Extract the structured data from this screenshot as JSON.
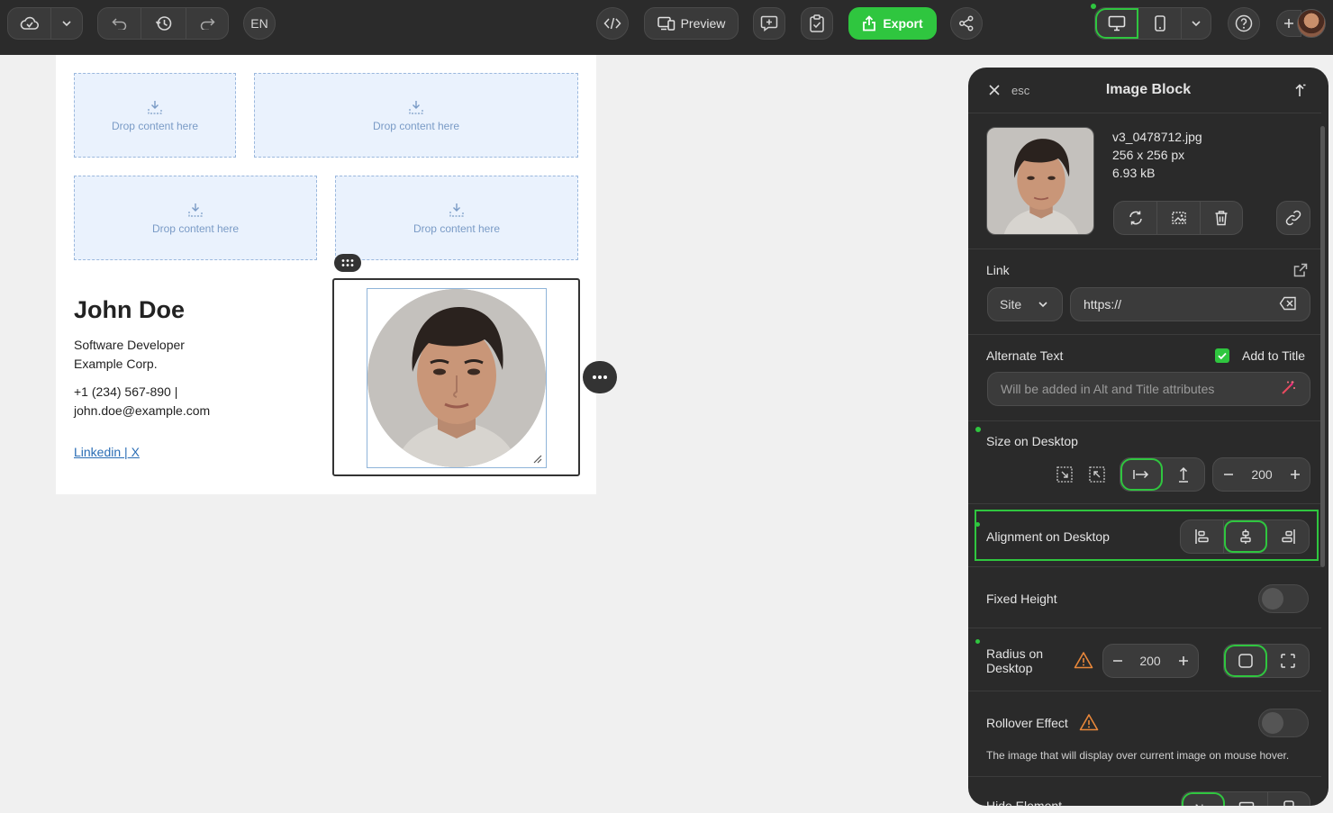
{
  "toolbar": {
    "language": "EN",
    "preview_label": "Preview",
    "export_label": "Export"
  },
  "canvas": {
    "drop_zone_label": "Drop content here",
    "signature": {
      "name": "John Doe",
      "role": "Software Developer",
      "company": "Example Corp.",
      "phone": "+1 (234) 567-890 |",
      "email": "john.doe@example.com",
      "link_linkedin": "Linkedin ",
      "link_separator": "|",
      "link_x": " X"
    }
  },
  "panel": {
    "esc_label": "esc",
    "title": "Image Block",
    "file": {
      "name": "v3_0478712.jpg",
      "dimensions": "256 x 256 px",
      "size": "6.93 kB"
    },
    "link": {
      "label": "Link",
      "type": "Site",
      "placeholder": "https://"
    },
    "alt_text": {
      "label": "Alternate Text",
      "add_to_title_label": "Add to Title",
      "add_to_title_checked": true,
      "placeholder": "Will be added in Alt and Title attributes"
    },
    "size": {
      "label": "Size on Desktop",
      "value": "200"
    },
    "alignment": {
      "label": "Alignment on Desktop",
      "selected": "center"
    },
    "fixed_height": {
      "label": "Fixed Height",
      "enabled": false
    },
    "radius": {
      "label_line1": "Radius on",
      "label_line2": "Desktop",
      "value": "200"
    },
    "rollover": {
      "label": "Rollover Effect",
      "enabled": false,
      "description": "The image that will display over current image on mouse hover."
    },
    "hide_element": {
      "label": "Hide Element",
      "option_no": "No"
    }
  },
  "colors": {
    "accent_green": "#2fc63f",
    "toolbar_bg": "#2b2b2b",
    "panel_bg": "#2a2a2a",
    "warning_orange": "#e8873a",
    "link_blue": "#2a6db5"
  }
}
